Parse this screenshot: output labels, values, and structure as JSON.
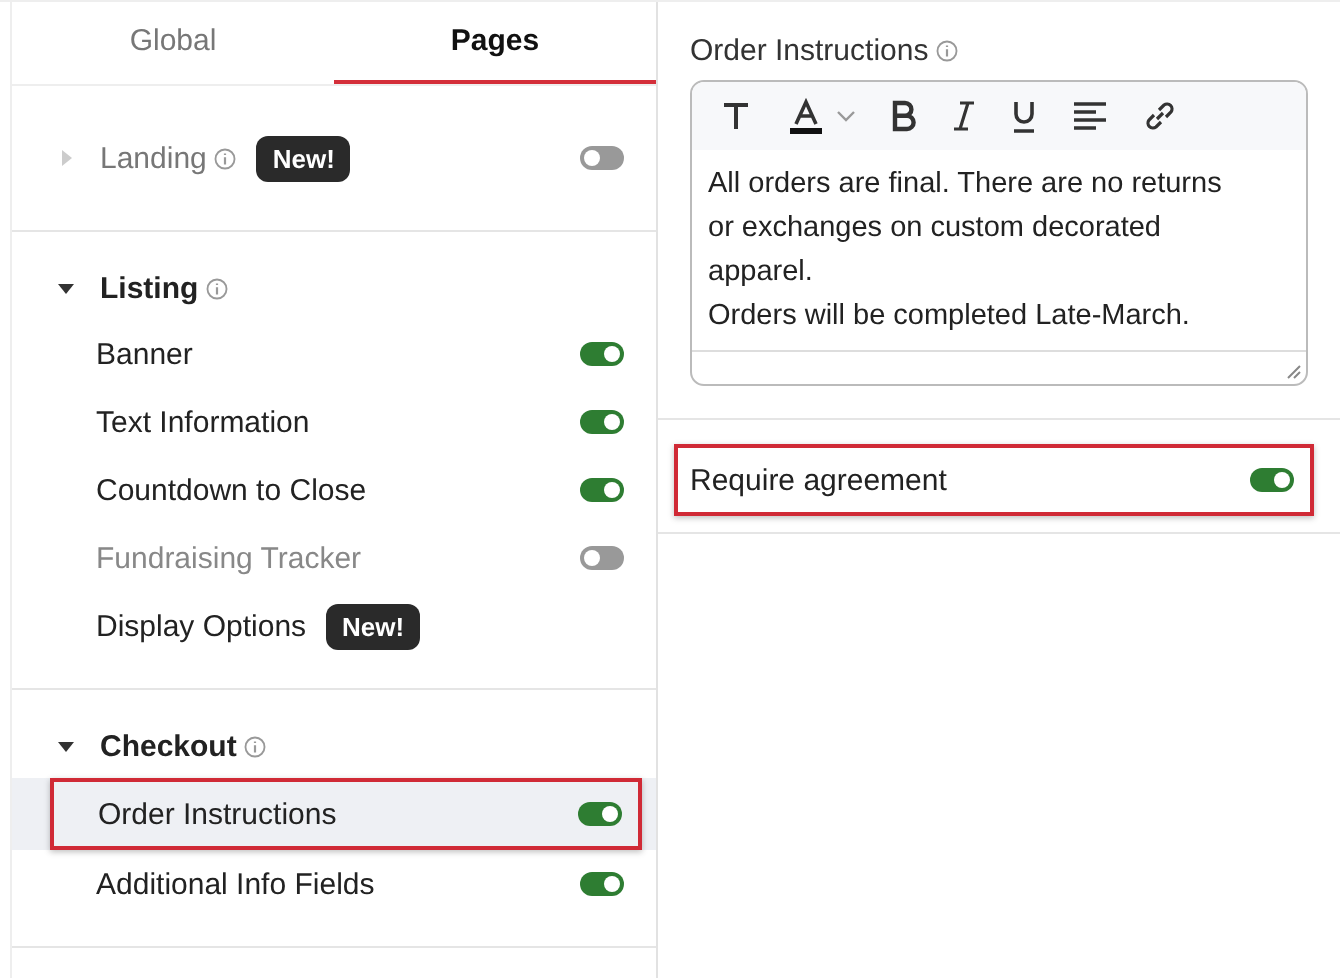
{
  "tabs": [
    {
      "label": "Global",
      "selected": false
    },
    {
      "label": "Pages",
      "selected": true
    }
  ],
  "sections": [
    {
      "title": "Landing",
      "expanded": false,
      "badge": "New!",
      "on": false
    },
    {
      "title": "Listing",
      "expanded": true,
      "items": [
        {
          "label": "Banner",
          "on": true,
          "disabled": false,
          "selected": false,
          "highlighted": false
        },
        {
          "label": "Text Information",
          "on": true,
          "disabled": false,
          "selected": false,
          "highlighted": false
        },
        {
          "label": "Countdown to Close",
          "on": true,
          "disabled": false,
          "selected": false,
          "highlighted": false
        },
        {
          "label": "Fundraising Tracker",
          "on": false,
          "disabled": true,
          "selected": false,
          "highlighted": false
        },
        {
          "label": "Display Options",
          "badge": "New!",
          "disabled": false,
          "selected": false,
          "highlighted": false
        }
      ]
    },
    {
      "title": "Checkout",
      "expanded": true,
      "items": [
        {
          "label": "Order Instructions",
          "on": true,
          "disabled": false,
          "selected": true,
          "highlighted": true
        },
        {
          "label": "Additional Info Fields",
          "on": true,
          "disabled": false,
          "selected": false,
          "highlighted": false
        }
      ]
    }
  ],
  "editor": {
    "label": "Order Instructions",
    "paragraphs": [
      "All orders are final. There are no returns or exchanges on custom decorated apparel.",
      "Orders will be completed Late-March."
    ]
  },
  "require_agreement": {
    "label": "Require agreement",
    "on": true,
    "highlighted": true
  }
}
